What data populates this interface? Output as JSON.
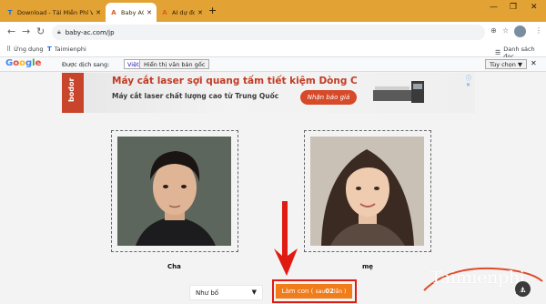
{
  "browser": {
    "tabs": [
      {
        "favicon": "T",
        "title": "Download - Tải Miễn Phí VN - Ph",
        "active": false
      },
      {
        "favicon": "A",
        "title": "Baby AC",
        "active": true
      },
      {
        "favicon": "A",
        "title": "AI dự đoán khuôn m",
        "active": false
      }
    ],
    "new_tab": "+",
    "window_controls": {
      "minimize": "—",
      "maximize": "❐",
      "close": "✕"
    },
    "url": "baby-ac.com/jp",
    "bookmarks": [
      {
        "icon": "grid-icon",
        "glyph": "⠿",
        "label": "Ứng dụng"
      },
      {
        "icon": "taimienphi-icon",
        "glyph": "T",
        "label": "Taimienphi"
      }
    ],
    "reading_list": "Danh sách đọc"
  },
  "translate_bar": {
    "logo": [
      "G",
      "o",
      "o",
      "g",
      "l",
      "e"
    ],
    "label": "Được dịch sang:",
    "language": "Việt",
    "show_original": "Hiển thị văn bản gốc",
    "options": "Tùy chọn ▼",
    "close": "✕"
  },
  "ad": {
    "brand": "bodor",
    "title": "Máy cắt laser sợi quang tấm tiết kiệm Dòng C",
    "subtitle": "Máy cắt laser chất lượng cao từ Trung Quốc",
    "cta": "Nhận báo giá",
    "info": "ⓘ ✕"
  },
  "parents": {
    "father_label": "Cha",
    "mother_label": "mẹ"
  },
  "controls": {
    "select_value": "Như bố",
    "select_caret": "▼",
    "make_child_prefix": "Làm con (",
    "make_child_remaining_prefix": "sau ",
    "make_child_count": "02",
    "make_child_suffix": " lần )"
  },
  "watermark": {
    "text": "Taimienphi",
    "suffix": ".vn"
  },
  "colors": {
    "tab_bar": "#e3a234",
    "button_orange": "#f07c1a",
    "highlight_red": "#e01b12",
    "ad_red": "#c23a22"
  }
}
